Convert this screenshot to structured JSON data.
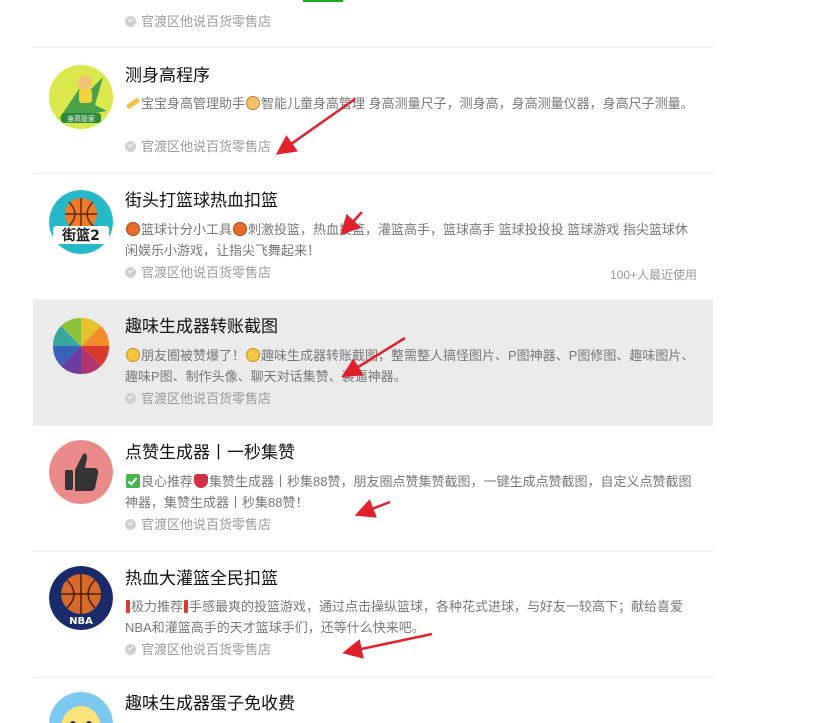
{
  "list": {
    "top_partial": {
      "merchant": "官渡区他说百货零售店"
    },
    "items": [
      {
        "title": "测身高程序",
        "desc_parts": [
          "宝宝身高管理助手",
          "智能儿童身高管理 身高测量尺子，测身高，身高测量仪器，身高尺子测量。"
        ],
        "merchant": "官渡区他说百货零售店",
        "avatar_icon": "height-manager-avatar",
        "avatar_text": "身高管家"
      },
      {
        "title": "街头打篮球热血扣篮",
        "desc_parts": [
          "篮球计分小工具",
          "刺激投篮，热血投篮，灌篮高手，篮球高手 篮球投投投 篮球游戏 指尖篮球休闲娱乐小游戏，让指尖飞舞起来！"
        ],
        "merchant": "官渡区他说百货零售店",
        "usage": "100+人最近使用",
        "avatar_icon": "street-basketball-avatar",
        "avatar_text": "街篮2"
      },
      {
        "title": "趣味生成器转账截图",
        "desc_parts": [
          "朋友圈被赞爆了！",
          "趣味生成器转账截图，整需整人搞怪图片、P图神器、P图修图、趣味图片、趣味P图、制作头像、聊天对话集赞、装逼神器。"
        ],
        "merchant": "官渡区他说百货零售店",
        "avatar_icon": "color-wheel-avatar"
      },
      {
        "title": "点赞生成器丨一秒集赞",
        "desc_parts": [
          "良心推荐",
          "集赞生成器丨秒集88赞，朋友圈点赞集赞截图，一键生成点赞截图，自定义点赞截图神器，集赞生成器丨秒集88赞！"
        ],
        "merchant": "官渡区他说百货零售店",
        "avatar_icon": "thumbs-up-avatar"
      },
      {
        "title": "热血大灌篮全民扣篮",
        "desc_parts": [
          "极力推荐",
          "手感最爽的投篮游戏，通过点击操纵篮球，各种花式进球，与好友一较高下；献给喜爱NBA和灌篮高手的天才篮球手们，还等什么快来吧。"
        ],
        "merchant": "官渡区他说百货零售店",
        "avatar_icon": "nba-basketball-avatar",
        "avatar_text": "NBA"
      },
      {
        "title": "趣味生成器蛋子免收费",
        "avatar_icon": "cartoon-egg-avatar"
      }
    ]
  },
  "colors": {
    "accent_green": "#1aad19",
    "highlight_row": "#ebebeb",
    "annotation_arrow": "#e0202a"
  }
}
